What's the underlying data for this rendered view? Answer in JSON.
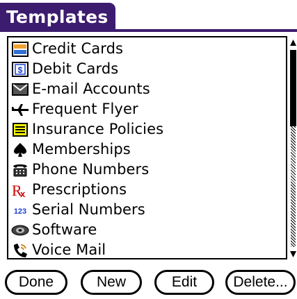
{
  "title": "Templates",
  "items": [
    {
      "label": "Credit Cards",
      "icon": "credit-card-icon"
    },
    {
      "label": "Debit Cards",
      "icon": "debit-card-icon"
    },
    {
      "label": "E-mail Accounts",
      "icon": "envelope-icon"
    },
    {
      "label": "Frequent Flyer",
      "icon": "airplane-icon"
    },
    {
      "label": "Insurance Policies",
      "icon": "document-lines-icon"
    },
    {
      "label": "Memberships",
      "icon": "spade-icon"
    },
    {
      "label": "Phone Numbers",
      "icon": "telephone-icon"
    },
    {
      "label": "Prescriptions",
      "icon": "rx-icon"
    },
    {
      "label": "Serial Numbers",
      "icon": "numbers-123-icon"
    },
    {
      "label": "Software",
      "icon": "disc-icon"
    },
    {
      "label": "Voice Mail",
      "icon": "voicemail-phone-icon"
    }
  ],
  "icon_text": {
    "debit": "$",
    "rx_r": "R",
    "rx_x": "x",
    "numbers": "123"
  },
  "buttons": {
    "done": "Done",
    "new": "New",
    "edit": "Edit",
    "delete": "Delete..."
  },
  "colors": {
    "title_bg": "#3c1c6e",
    "rx_red": "#cc0000",
    "numbers_blue": "#1a3fd0",
    "credit_orange": "#f0a030",
    "credit_blue": "#3070d0",
    "insurance_yellow": "#ffff00"
  }
}
